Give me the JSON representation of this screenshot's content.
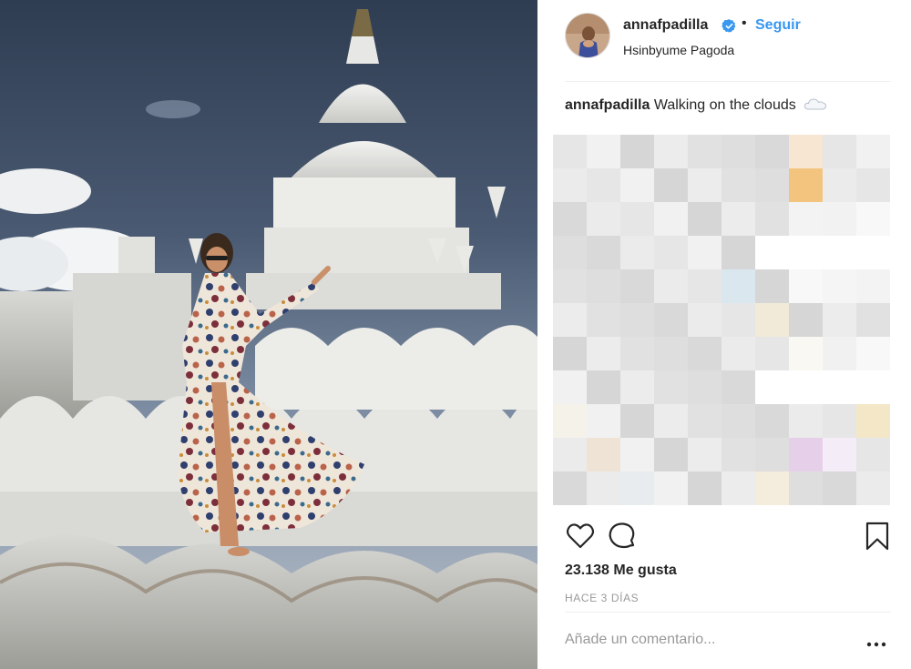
{
  "post": {
    "username": "annafpadilla",
    "separator": "•",
    "follow_label": "Seguir",
    "location": "Hsinbyume Pagoda",
    "caption_user": "annafpadilla",
    "caption_text": "Walking on the clouds",
    "likes": "23.138 Me gusta",
    "time_ago": "HACE 3 DÍAS",
    "comment_placeholder": "Añade un comentario..."
  },
  "colors": {
    "follow": "#3897f0",
    "verified": "#3897f0",
    "text": "#262626",
    "muted": "#999999",
    "divider": "#efefef"
  },
  "icons": {
    "verified": "verified-badge-icon",
    "caption_emoji": "cloud-icon",
    "like": "heart-icon",
    "comment": "comment-bubble-icon",
    "save": "bookmark-icon",
    "more": "more-options-icon"
  }
}
